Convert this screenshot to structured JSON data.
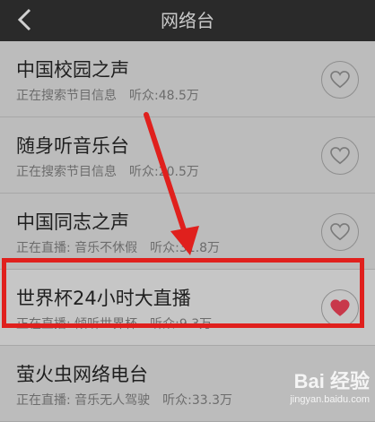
{
  "header": {
    "title": "网络台"
  },
  "stations": [
    {
      "name": "中国校园之声",
      "status": "正在搜索节目信息",
      "listeners": "听众:48.5万",
      "favorited": false
    },
    {
      "name": "随身听音乐台",
      "status": "正在搜索节目信息",
      "listeners": "听众:20.5万",
      "favorited": false
    },
    {
      "name": "中国同志之声",
      "status": "正在直播: 音乐不休假",
      "listeners": "听众:31.8万",
      "favorited": false
    },
    {
      "name": "世界杯24小时大直播",
      "status": "正在直播: 倾听世界杯",
      "listeners": "听众:9.3万",
      "favorited": true
    },
    {
      "name": "萤火虫网络电台",
      "status": "正在直播: 音乐无人驾驶",
      "listeners": "听众:33.3万",
      "favorited": false
    }
  ],
  "colors": {
    "highlight": "#e0201d",
    "header_bg": "#2a2a2a",
    "heart_on": "#c8384a"
  },
  "watermark": {
    "logo": "Bai 经验",
    "url": "jingyan.baidu.com"
  }
}
